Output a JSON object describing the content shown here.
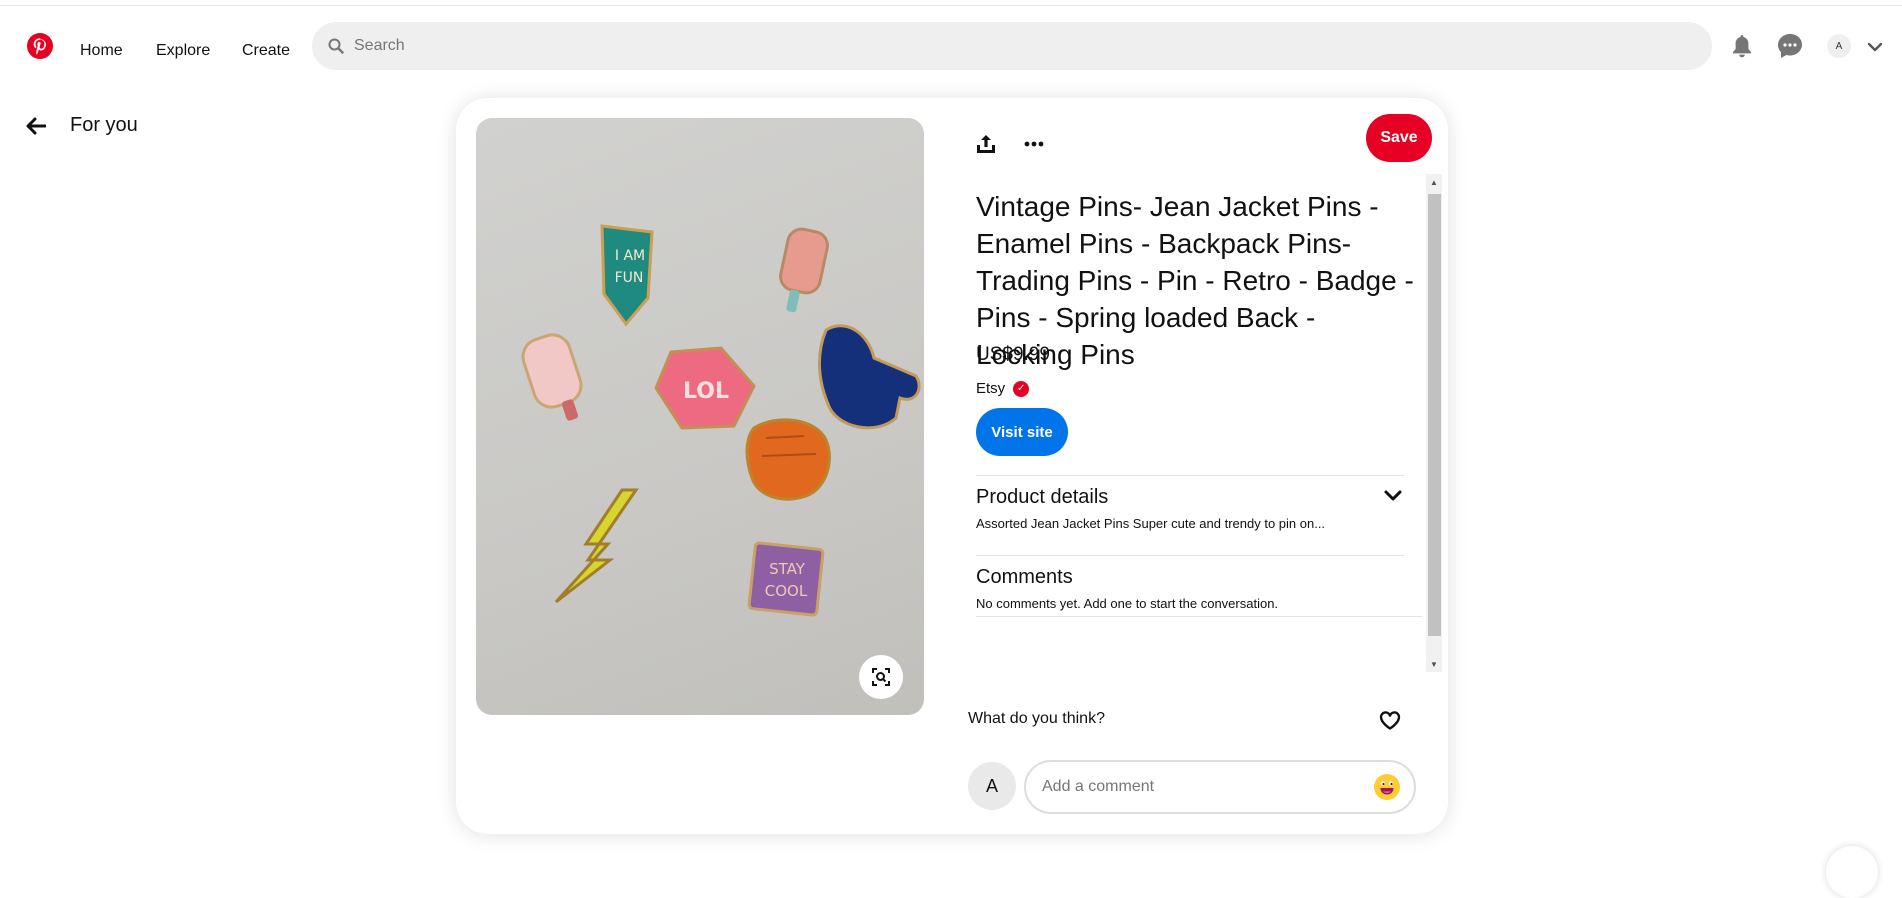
{
  "header": {
    "nav": [
      {
        "label": "Home"
      },
      {
        "label": "Explore"
      },
      {
        "label": "Create"
      }
    ],
    "search_placeholder": "Search",
    "avatar_initial": "A",
    "brand_color": "#e60023"
  },
  "back": {
    "label": "For you"
  },
  "pin": {
    "title": "Vintage Pins- Jean Jacket Pins - Enamel Pins - Backpack Pins- Trading Pins - Pin - Retro - Badge - Pins - Spring loaded Back - Locking Pins",
    "price": "US$9.99",
    "merchant": "Etsy",
    "save_label": "Save",
    "visit_label": "Visit site",
    "image_pins": {
      "fun_line1": "I AM",
      "fun_line2": "FUN",
      "lol": "LOL",
      "cool_line1": "STAY",
      "cool_line2": "COOL"
    }
  },
  "details": {
    "title": "Product details",
    "summary": "Assorted Jean Jacket Pins Super cute and trendy to pin on..."
  },
  "comments": {
    "title": "Comments",
    "empty_text": "No comments yet. Add one to start the conversation.",
    "prompt": "What do you think?",
    "input_placeholder": "Add a comment",
    "avatar_initial": "A"
  },
  "icons": [
    "pinterest-logo-icon",
    "search-icon",
    "bell-icon",
    "chat-icon",
    "chevron-down-icon",
    "arrow-left-icon",
    "share-icon",
    "more-icon",
    "lens-icon",
    "verified-icon",
    "heart-icon",
    "emoji-icon"
  ],
  "colors": {
    "save": "#e60023",
    "visit": "#0074e8",
    "surface": "#efefef"
  }
}
